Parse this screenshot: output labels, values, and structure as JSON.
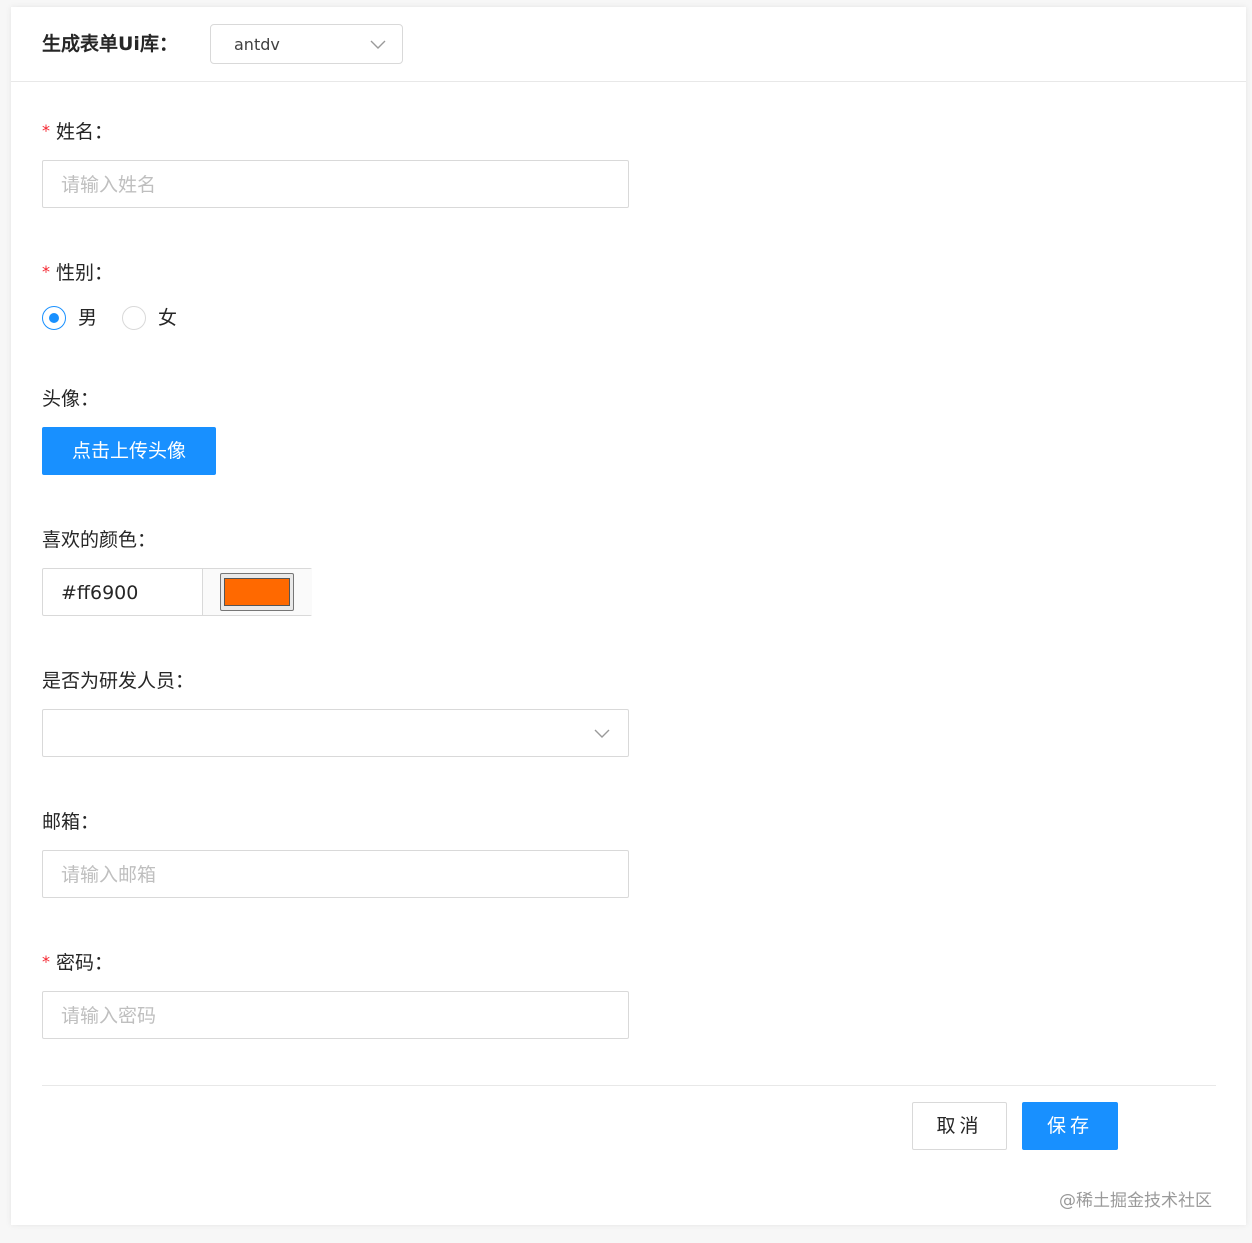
{
  "header": {
    "label": "生成表单Ui库：",
    "library_select": {
      "value": "antdv",
      "icon": "chevron-down-icon"
    }
  },
  "form": {
    "name": {
      "required_mark": "*",
      "label": "姓名：",
      "placeholder": "请输入姓名"
    },
    "gender": {
      "required_mark": "*",
      "label": "性别：",
      "options": [
        {
          "label": "男",
          "checked": true
        },
        {
          "label": "女",
          "checked": false
        }
      ]
    },
    "avatar": {
      "label": "头像：",
      "upload_button": "点击上传头像"
    },
    "favorite_color": {
      "label": "喜欢的颜色：",
      "value": "#ff6900",
      "swatch_color": "#ff6900"
    },
    "is_developer": {
      "label": "是否为研发人员：",
      "value": "",
      "icon": "chevron-down-icon"
    },
    "email": {
      "label": "邮箱：",
      "placeholder": "请输入邮箱"
    },
    "password": {
      "required_mark": "*",
      "label": "密码：",
      "placeholder": "请输入密码"
    }
  },
  "footer": {
    "cancel_label": "取消",
    "save_label": "保存"
  },
  "watermark": "@稀土掘金技术社区",
  "colors": {
    "primary": "#1890ff",
    "required": "#f5222d",
    "border": "#d9d9d9",
    "placeholder": "#bfbfbf"
  }
}
